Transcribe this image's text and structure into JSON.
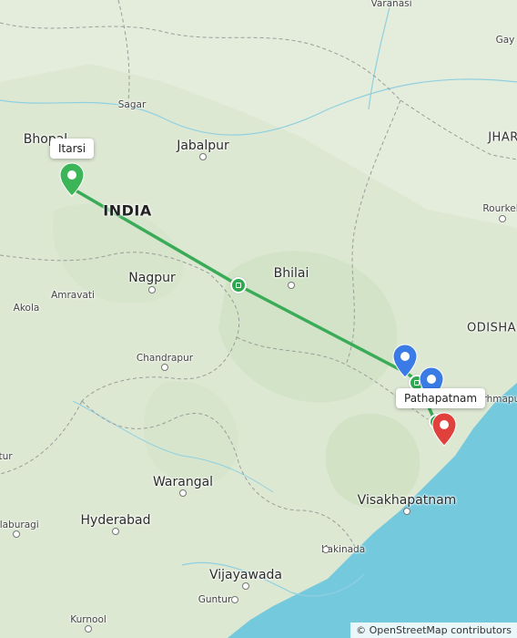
{
  "map": {
    "attribution": "© OpenStreetMap contributors",
    "colors": {
      "land": "#dde8d3",
      "water": "#74c9dd",
      "route": "#3aab58",
      "pin_start": "#3cb458",
      "pin_end": "#e0413c",
      "pin_waypoint": "#3b7be6"
    },
    "tooltips": {
      "start": "Itarsi",
      "end": "Pathapatnam"
    },
    "places": {
      "varanasi": "Varanasi",
      "gaya": "Gay",
      "sagar": "Sagar",
      "bhopal": "Bhopal",
      "jabalpur": "Jabalpur",
      "india": "INDIA",
      "jharkhand": "JHAR",
      "rourkela": "Rourkel",
      "nagpur": "Nagpur",
      "bhilai": "Bhilai",
      "amravati": "Amravati",
      "akola": "Akola",
      "odisha": "ODISHA",
      "chandrapur": "Chandrapur",
      "brahmapur": "rhmapur",
      "tur": "tur",
      "warangal": "Warangal",
      "hyderabad": "Hyderabad",
      "visakhapatnam": "Visakhapatnam",
      "kalaburagi": "alaburagi",
      "kakinada": "Kakinada",
      "vijayawada": "Vijayawada",
      "guntur": "Guntur",
      "kurnool": "Kurnool"
    },
    "icons": {
      "start_pin": "map-pin-icon",
      "end_pin": "map-pin-icon",
      "waypoint_pin": "map-pin-icon",
      "route_marker": "rail-icon"
    }
  }
}
